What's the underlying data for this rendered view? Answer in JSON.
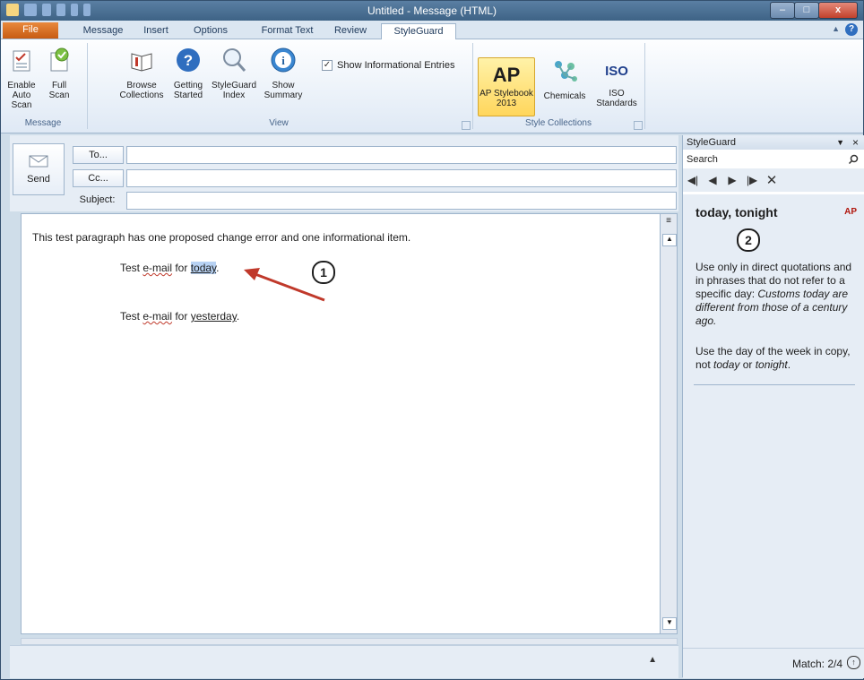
{
  "window": {
    "title": "Untitled - Message (HTML)",
    "minimize": "–",
    "maximize": "□",
    "close": "x"
  },
  "tabs": [
    {
      "label": "File"
    },
    {
      "label": "Message"
    },
    {
      "label": "Insert"
    },
    {
      "label": "Options"
    },
    {
      "label": "Format Text"
    },
    {
      "label": "Review"
    },
    {
      "label": "StyleGuard"
    }
  ],
  "ribbon": {
    "message_group": {
      "label": "Message",
      "buttons": [
        {
          "label_line1": "Enable",
          "label_line2": "Auto Scan",
          "icon": "auto-scan-icon"
        },
        {
          "label_line1": "Full",
          "label_line2": "Scan",
          "icon": "full-scan-icon"
        }
      ]
    },
    "view_group": {
      "label": "View",
      "buttons": [
        {
          "label_line1": "Browse",
          "label_line2": "Collections",
          "icon": "book-icon"
        },
        {
          "label_line1": "Getting",
          "label_line2": "Started",
          "icon": "question-icon"
        },
        {
          "label_line1": "StyleGuard",
          "label_line2": "Index",
          "icon": "magnifier-icon"
        },
        {
          "label_line1": "Show",
          "label_line2": "Summary",
          "icon": "info-icon"
        }
      ],
      "checkbox_label": "Show Informational Entries",
      "checkbox_mark": "✓"
    },
    "style_collections_group": {
      "label": "Style Collections",
      "buttons": [
        {
          "label_line1": "AP Stylebook",
          "label_line2": "2013",
          "icon_text": "AP"
        },
        {
          "label_line1": "Chemicals",
          "label_line2": "",
          "icon": "molecule-icon"
        },
        {
          "label_line1": "ISO",
          "label_line2": "Standards",
          "icon_text": "ISO"
        }
      ]
    }
  },
  "compose": {
    "send_label": "Send",
    "to_label": "To...",
    "cc_label": "Cc...",
    "subject_label": "Subject:"
  },
  "body": {
    "paragraph1": "This test paragraph has one proposed change error and one informational item.",
    "line2_prefix": "Test ",
    "line2_word1": "e-mail",
    "line2_mid": " for ",
    "line2_highlight": "today",
    "line2_suffix": ".",
    "line3_prefix": "Test ",
    "line3_word1": "e-mail",
    "line3_mid": " for ",
    "line3_word2": "yesterday",
    "line3_suffix": "."
  },
  "markers": {
    "m1": "1",
    "m2": "2"
  },
  "pane": {
    "title": "StyleGuard",
    "search_label": "Search",
    "entry_title": "today, tonight",
    "entry_source": "AP",
    "text1": "Use only in direct quotations and in phrases that do not refer to a specific day:",
    "text1_example": "Customs today are different from those of a century ago.",
    "text2_prefix": "Use the day of the week in copy, not ",
    "text2_today": "today",
    "text2_or": " or ",
    "text2_tonight": "tonight",
    "text2_end": ".",
    "match": "Match: 2/4"
  },
  "colors": {
    "accent": "#c75b12",
    "arrow": "#c0392b"
  }
}
